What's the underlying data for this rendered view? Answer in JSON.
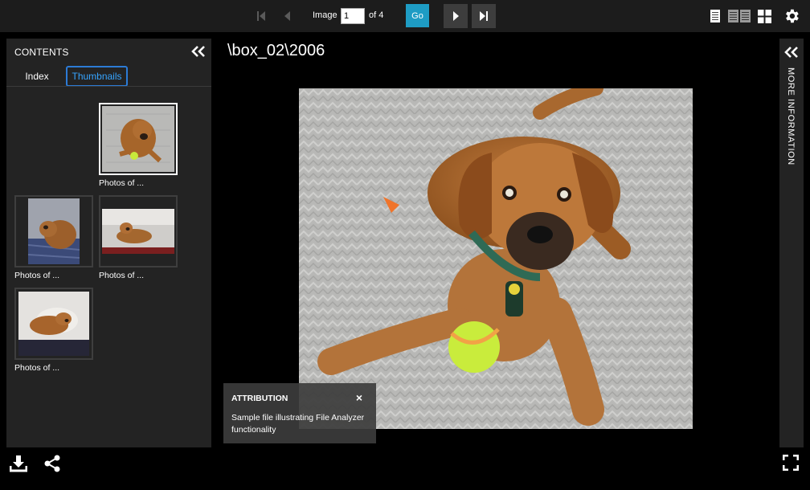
{
  "toolbar": {
    "image_label": "Image",
    "page_value": "1",
    "of_label": "of 4",
    "go_label": "Go"
  },
  "contents": {
    "title": "CONTENTS",
    "tabs": [
      {
        "label": "Index",
        "active": false
      },
      {
        "label": "Thumbnails",
        "active": true
      }
    ],
    "thumbnails": [
      {
        "caption": "Photos of ...",
        "selected": true
      },
      {
        "caption": "Photos of ...",
        "selected": false
      },
      {
        "caption": "Photos of ...",
        "selected": false
      },
      {
        "caption": "Photos of ...",
        "selected": false
      }
    ]
  },
  "viewer": {
    "path_title": "\\box_02\\2006"
  },
  "attribution": {
    "title": "ATTRIBUTION",
    "close": "×",
    "text": "Sample file illustrating File Analyzer functionality"
  },
  "right_panel": {
    "label": "MORE INFORMATION"
  },
  "icons": {
    "first": "first-page-icon",
    "prev": "prev-page-icon",
    "next": "next-page-icon",
    "last": "last-page-icon",
    "view_one": "one-up-icon",
    "view_two": "two-up-icon",
    "view_grid": "gallery-icon",
    "settings": "gear-icon",
    "download": "download-icon",
    "share": "share-icon",
    "fullscreen": "fullscreen-icon"
  },
  "colors": {
    "accent": "#1e9cc4",
    "tab_active": "#36a4ff",
    "panel_bg": "#232323",
    "topbar_bg": "#1c1c1c"
  }
}
